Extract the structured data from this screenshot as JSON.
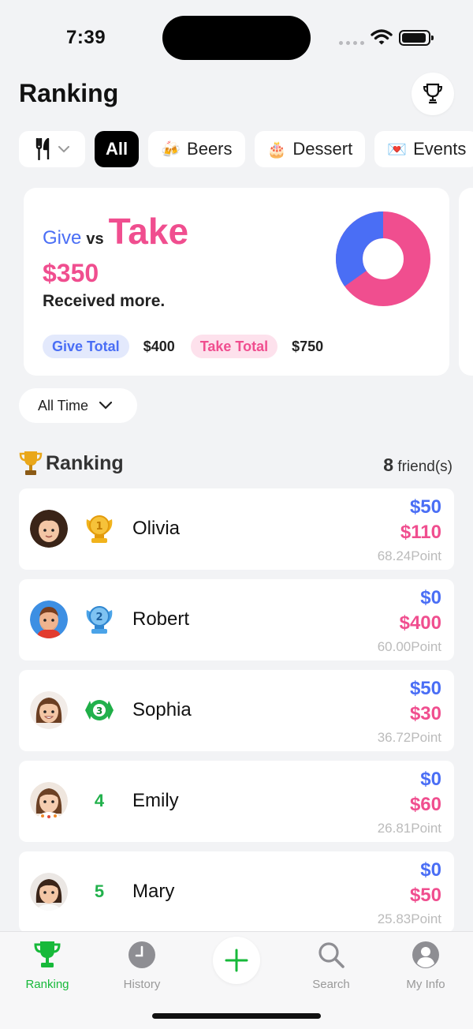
{
  "status": {
    "time": "7:39"
  },
  "header": {
    "title": "Ranking"
  },
  "filters": [
    {
      "emoji": "",
      "label": "All",
      "active": true
    },
    {
      "emoji": "🍻",
      "label": "Beers",
      "active": false
    },
    {
      "emoji": "🎂",
      "label": "Dessert",
      "active": false
    },
    {
      "emoji": "💌",
      "label": "Events",
      "active": false
    }
  ],
  "summary": {
    "give_word": "Give",
    "vs_word": "vs",
    "take_word": "Take",
    "difference": "$350",
    "verdict": "Received more.",
    "give_total_label": "Give Total",
    "give_total": "$400",
    "take_total_label": "Take Total",
    "take_total": "$750",
    "give_fraction": 0.348,
    "colors": {
      "give": "#4a6ef5",
      "take": "#f04e8f"
    }
  },
  "range": {
    "label": "All Time"
  },
  "ranking": {
    "title": "Ranking",
    "count": "8",
    "count_suffix": "friend(s)",
    "rows": [
      {
        "rank": "1",
        "name": "Olivia",
        "give": "$50",
        "take": "$110",
        "points": "68.24Point"
      },
      {
        "rank": "2",
        "name": "Robert",
        "give": "$0",
        "take": "$400",
        "points": "60.00Point"
      },
      {
        "rank": "3",
        "name": "Sophia",
        "give": "$50",
        "take": "$30",
        "points": "36.72Point"
      },
      {
        "rank": "4",
        "name": "Emily",
        "give": "$0",
        "take": "$60",
        "points": "26.81Point"
      },
      {
        "rank": "5",
        "name": "Mary",
        "give": "$0",
        "take": "$50",
        "points": "25.83Point"
      }
    ]
  },
  "tabbar": {
    "tabs": [
      {
        "label": "Ranking",
        "icon": "trophy-icon",
        "active": true
      },
      {
        "label": "History",
        "icon": "clock-icon",
        "active": false
      },
      {
        "label": "",
        "icon": "plus-icon",
        "active": false
      },
      {
        "label": "Search",
        "icon": "search-icon",
        "active": false
      },
      {
        "label": "My Info",
        "icon": "person-icon",
        "active": false
      }
    ]
  }
}
